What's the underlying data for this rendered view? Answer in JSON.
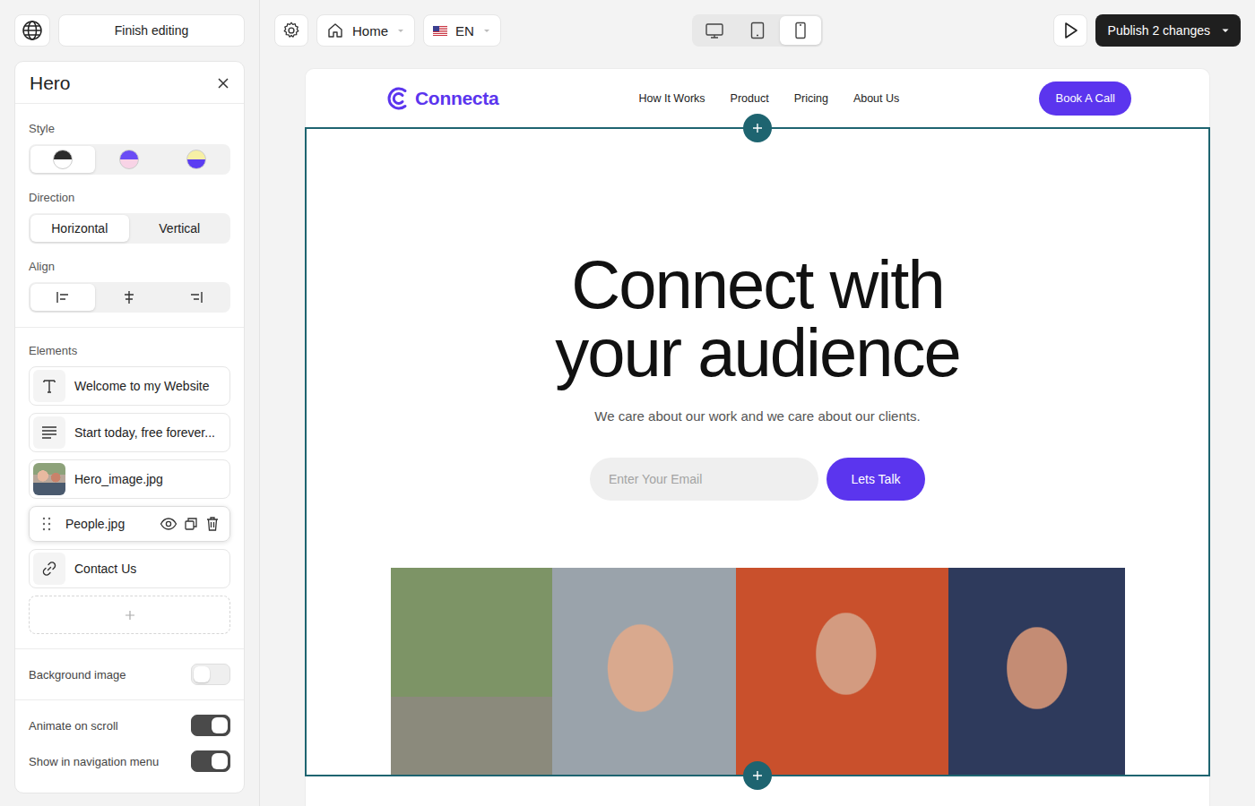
{
  "app": {
    "finish_editing": "Finish editing"
  },
  "toolbar": {
    "page": "Home",
    "language": "EN",
    "devices": [
      {
        "kind": "desktop",
        "selected": false
      },
      {
        "kind": "tablet",
        "selected": false
      },
      {
        "kind": "mobile",
        "selected": true
      }
    ],
    "publish": "Publish 2 changes"
  },
  "panel": {
    "title": "Hero",
    "style": {
      "label": "Style",
      "options": [
        {
          "colors": [
            "#2b2b2b",
            "#ffffff"
          ],
          "selected": true
        },
        {
          "colors": [
            "#6a4cf5",
            "#f8d3e6"
          ],
          "selected": false
        },
        {
          "colors": [
            "#f7f0a6",
            "#5b3df2"
          ],
          "selected": false
        }
      ]
    },
    "direction": {
      "label": "Direction",
      "options": [
        {
          "label": "Horizontal",
          "selected": true
        },
        {
          "label": "Vertical",
          "selected": false
        }
      ]
    },
    "align": {
      "label": "Align",
      "options": [
        {
          "kind": "left",
          "selected": true
        },
        {
          "kind": "center",
          "selected": false
        },
        {
          "kind": "right",
          "selected": false
        }
      ]
    },
    "elements": {
      "label": "Elements",
      "items": [
        {
          "label": "Welcome to my Website",
          "kind": "text",
          "hovered": false
        },
        {
          "label": "Start today, free forever...",
          "kind": "paragraph",
          "hovered": false
        },
        {
          "label": "Hero_image.jpg",
          "kind": "image",
          "hovered": false
        },
        {
          "label": "People.jpg",
          "kind": "image",
          "hovered": true
        },
        {
          "label": "Contact Us",
          "kind": "link",
          "hovered": false
        }
      ]
    },
    "toggles": [
      {
        "label": "Background image",
        "on": false
      },
      {
        "label": "Animate on scroll",
        "on": true
      },
      {
        "label": "Show in navigation menu",
        "on": true
      }
    ]
  },
  "site": {
    "logo": "Connecta",
    "nav": [
      "How It Works",
      "Product",
      "Pricing",
      "About Us"
    ],
    "cta": "Book A Call",
    "hero": {
      "selected": true,
      "title_lines": [
        "Connect with",
        "your audience"
      ],
      "subtitle": "We care about our work and we care about our clients.",
      "email_placeholder": "Enter Your Email",
      "button": "Lets Talk"
    }
  }
}
